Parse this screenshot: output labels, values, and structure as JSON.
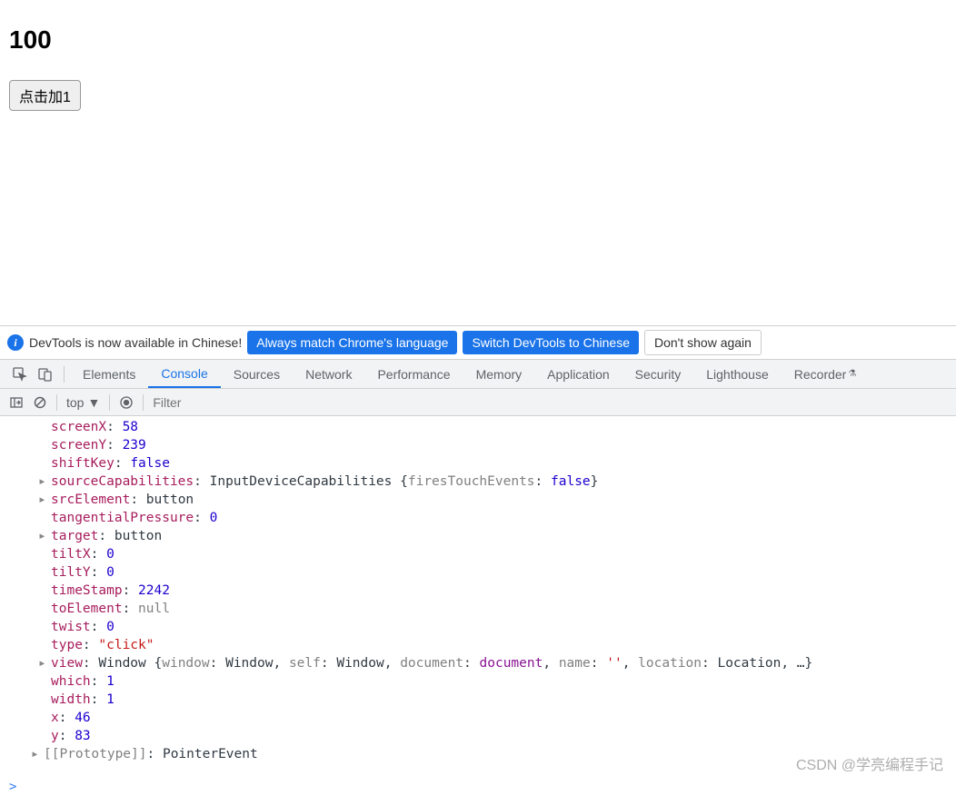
{
  "page": {
    "counter": "100",
    "button_label": "点击加1"
  },
  "infobar": {
    "message": "DevTools is now available in Chinese!",
    "btn_match": "Always match Chrome's language",
    "btn_switch": "Switch DevTools to Chinese",
    "btn_dismiss": "Don't show again"
  },
  "tabs": {
    "elements": "Elements",
    "console": "Console",
    "sources": "Sources",
    "network": "Network",
    "performance": "Performance",
    "memory": "Memory",
    "application": "Application",
    "security": "Security",
    "lighthouse": "Lighthouse",
    "recorder": "Recorder"
  },
  "toolbar": {
    "context": "top",
    "filter_placeholder": "Filter"
  },
  "console": {
    "lines": [
      {
        "arrow": false,
        "key": "screenX",
        "sep": ": ",
        "val": "58",
        "vclass": "k-num"
      },
      {
        "arrow": false,
        "key": "screenY",
        "sep": ": ",
        "val": "239",
        "vclass": "k-num"
      },
      {
        "arrow": false,
        "key": "shiftKey",
        "sep": ": ",
        "val": "false",
        "vclass": "k-bool"
      },
      {
        "arrow": true,
        "key": "sourceCapabilities",
        "sep": ": ",
        "complex": [
          {
            "t": "InputDeviceCapabilities {",
            "c": "k-class"
          },
          {
            "t": "firesTouchEvents",
            "c": "k-dim"
          },
          {
            "t": ": ",
            "c": "k-obj"
          },
          {
            "t": "false",
            "c": "k-bool"
          },
          {
            "t": "}",
            "c": "k-obj"
          }
        ]
      },
      {
        "arrow": true,
        "key": "srcElement",
        "sep": ": ",
        "val": "button",
        "vclass": "k-obj"
      },
      {
        "arrow": false,
        "key": "tangentialPressure",
        "sep": ": ",
        "val": "0",
        "vclass": "k-num"
      },
      {
        "arrow": true,
        "key": "target",
        "sep": ": ",
        "val": "button",
        "vclass": "k-obj"
      },
      {
        "arrow": false,
        "key": "tiltX",
        "sep": ": ",
        "val": "0",
        "vclass": "k-num"
      },
      {
        "arrow": false,
        "key": "tiltY",
        "sep": ": ",
        "val": "0",
        "vclass": "k-num"
      },
      {
        "arrow": false,
        "key": "timeStamp",
        "sep": ": ",
        "val": "2242",
        "vclass": "k-num"
      },
      {
        "arrow": false,
        "key": "toElement",
        "sep": ": ",
        "val": "null",
        "vclass": "k-null"
      },
      {
        "arrow": false,
        "key": "twist",
        "sep": ": ",
        "val": "0",
        "vclass": "k-num"
      },
      {
        "arrow": false,
        "key": "type",
        "sep": ": ",
        "val": "\"click\"",
        "vclass": "k-str"
      },
      {
        "arrow": true,
        "key": "view",
        "sep": ": ",
        "complex": [
          {
            "t": "Window {",
            "c": "k-class"
          },
          {
            "t": "window",
            "c": "k-dim"
          },
          {
            "t": ": ",
            "c": "k-obj"
          },
          {
            "t": "Window",
            "c": "k-obj"
          },
          {
            "t": ", ",
            "c": "k-obj"
          },
          {
            "t": "self",
            "c": "k-dim"
          },
          {
            "t": ": ",
            "c": "k-obj"
          },
          {
            "t": "Window",
            "c": "k-obj"
          },
          {
            "t": ", ",
            "c": "k-obj"
          },
          {
            "t": "document",
            "c": "k-dim"
          },
          {
            "t": ": ",
            "c": "k-obj"
          },
          {
            "t": "document",
            "c": "k-purple"
          },
          {
            "t": ", ",
            "c": "k-obj"
          },
          {
            "t": "name",
            "c": "k-dim"
          },
          {
            "t": ": ",
            "c": "k-obj"
          },
          {
            "t": "''",
            "c": "k-str"
          },
          {
            "t": ", ",
            "c": "k-obj"
          },
          {
            "t": "location",
            "c": "k-dim"
          },
          {
            "t": ": ",
            "c": "k-obj"
          },
          {
            "t": "Location",
            "c": "k-obj"
          },
          {
            "t": ", …}",
            "c": "k-obj"
          }
        ]
      },
      {
        "arrow": false,
        "key": "which",
        "sep": ": ",
        "val": "1",
        "vclass": "k-num"
      },
      {
        "arrow": false,
        "key": "width",
        "sep": ": ",
        "val": "1",
        "vclass": "k-num"
      },
      {
        "arrow": false,
        "key": "x",
        "sep": ": ",
        "val": "46",
        "vclass": "k-num"
      },
      {
        "arrow": false,
        "key": "y",
        "sep": ": ",
        "val": "83",
        "vclass": "k-num"
      }
    ],
    "proto_key": "[[Prototype]]",
    "proto_val": "PointerEvent",
    "prompt": ">"
  },
  "watermark": "CSDN @学亮编程手记"
}
